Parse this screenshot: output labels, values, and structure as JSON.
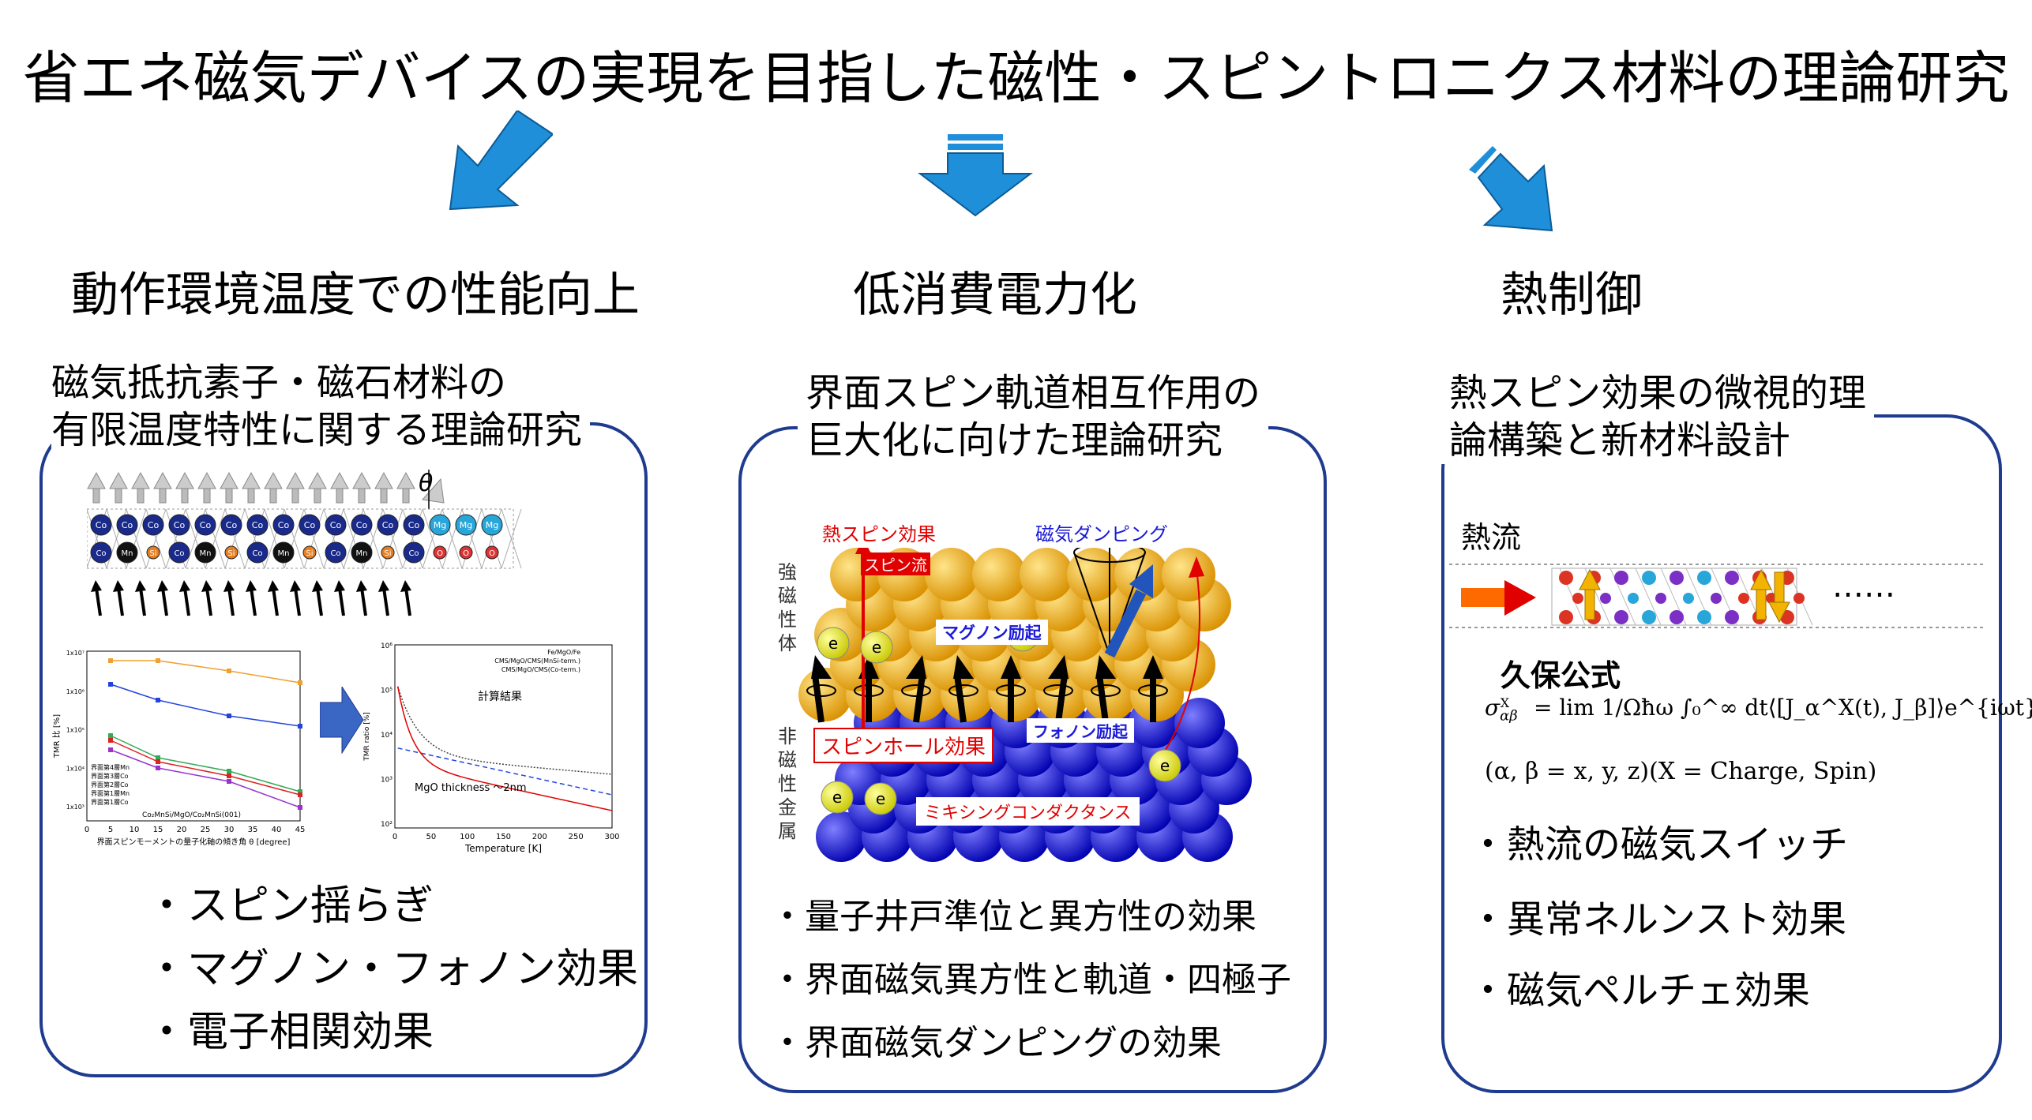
{
  "title": "省エネ磁気デバイスの実現を目指した磁性・スピントロニクス材料の理論研究",
  "columns": [
    {
      "heading": "動作環境温度での性能向上",
      "subtitle": [
        "磁気抵抗素子・磁石材料の",
        "有限温度特性に関する理論研究"
      ],
      "bullets": [
        "・スピン揺らぎ",
        "・マグノン・フォノン効果",
        "・電子相関効果"
      ],
      "figure": {
        "theta": "θ",
        "atoms_row1": [
          "Co",
          "Co",
          "Co",
          "Co",
          "Co",
          "Co",
          "Co",
          "Co",
          "Co",
          "Co",
          "Co",
          "Co",
          "Co",
          "Mg",
          "Mg",
          "Mg"
        ],
        "atoms_row2": [
          "Co",
          "Mn",
          "Si",
          "Co",
          "Mn",
          "Si",
          "Co",
          "Mn",
          "Si",
          "Co",
          "Mn",
          "Si",
          "Co",
          "O",
          "O",
          "O"
        ],
        "chart_left": {
          "ylabel": "TMR 比 [%]",
          "xlabel": "界面スピンモーメントの量子化軸の傾き角 θ [degree]",
          "x_ticks": [
            "0",
            "5",
            "10",
            "15",
            "20",
            "25",
            "30",
            "35",
            "40",
            "45"
          ],
          "y_ticks": [
            "1x10⁷",
            "1x10⁶",
            "1x10⁵",
            "1x10⁴",
            "1x10³"
          ],
          "legend": [
            "界面第4層Mn",
            "界面第3層Co",
            "界面第2層Co",
            "界面第1層Mn",
            "界面第1層Co"
          ],
          "note": "Co₂MnSi/MgO/Co₂MnSi(001)"
        },
        "chart_right": {
          "ylabel": "TMR ratio [%]",
          "xlabel": "Temperature [K]",
          "x_ticks": [
            "0",
            "50",
            "100",
            "150",
            "200",
            "250",
            "300"
          ],
          "y_ticks": [
            "10⁶",
            "10⁵",
            "10⁴",
            "10³",
            "10²"
          ],
          "legend": [
            "Fe/MgO/Fe",
            "CMS/MgO/CMS(MnSi-term.)",
            "CMS/MgO/CMS(Co-term.)"
          ],
          "label_result": "計算結果",
          "label_thickness": "MgO thickness ～2nm"
        }
      }
    },
    {
      "heading": "低消費電力化",
      "subtitle": [
        "界面スピン軌道相互作用の",
        "巨大化に向けた理論研究"
      ],
      "bullets": [
        "・量子井戸準位と異方性の効果",
        "・界面磁気異方性と軌道・四極子",
        "・界面磁気ダンピングの効果"
      ],
      "figure": {
        "thermal_spin": "熱スピン効果",
        "spin_current": "スピン流",
        "magnetic_damping": "磁気ダンピング",
        "magnon": "マグノン励起",
        "phonon": "フォノン励起",
        "spin_hall": "スピンホール効果",
        "mixing": "ミキシングコンダクタンス",
        "ferro_label": [
          "強",
          "磁",
          "性",
          "体"
        ],
        "nonmag_label": [
          "非",
          "磁",
          "性",
          "金",
          "属"
        ],
        "electron": "e"
      }
    },
    {
      "heading": "熱制御",
      "subtitle": [
        "熱スピン効果の微視的理",
        "論構築と新材料設計"
      ],
      "bullets": [
        "・熱流の磁気スイッチ",
        "・異常ネルンスト効果",
        "・磁気ペルチェ効果"
      ],
      "figure": {
        "heat_flow": "熱流",
        "dots": "……",
        "kubo": "久保公式",
        "formula_lhs": "σ",
        "formula": "= lim 1/Ωħω ∫₀^∞ dt⟨[J_α^X(t), J_β]⟩e^{iωt}",
        "formula_cond": "(α, β = x, y, z)(X = Charge, Spin)"
      }
    }
  ],
  "colors": {
    "panel_border": "#1f3b8f",
    "arrow_blue": "#1e8fd8",
    "red": "#e00000",
    "gold": "#f2b400",
    "blue_ball": "#1a1ad8"
  }
}
